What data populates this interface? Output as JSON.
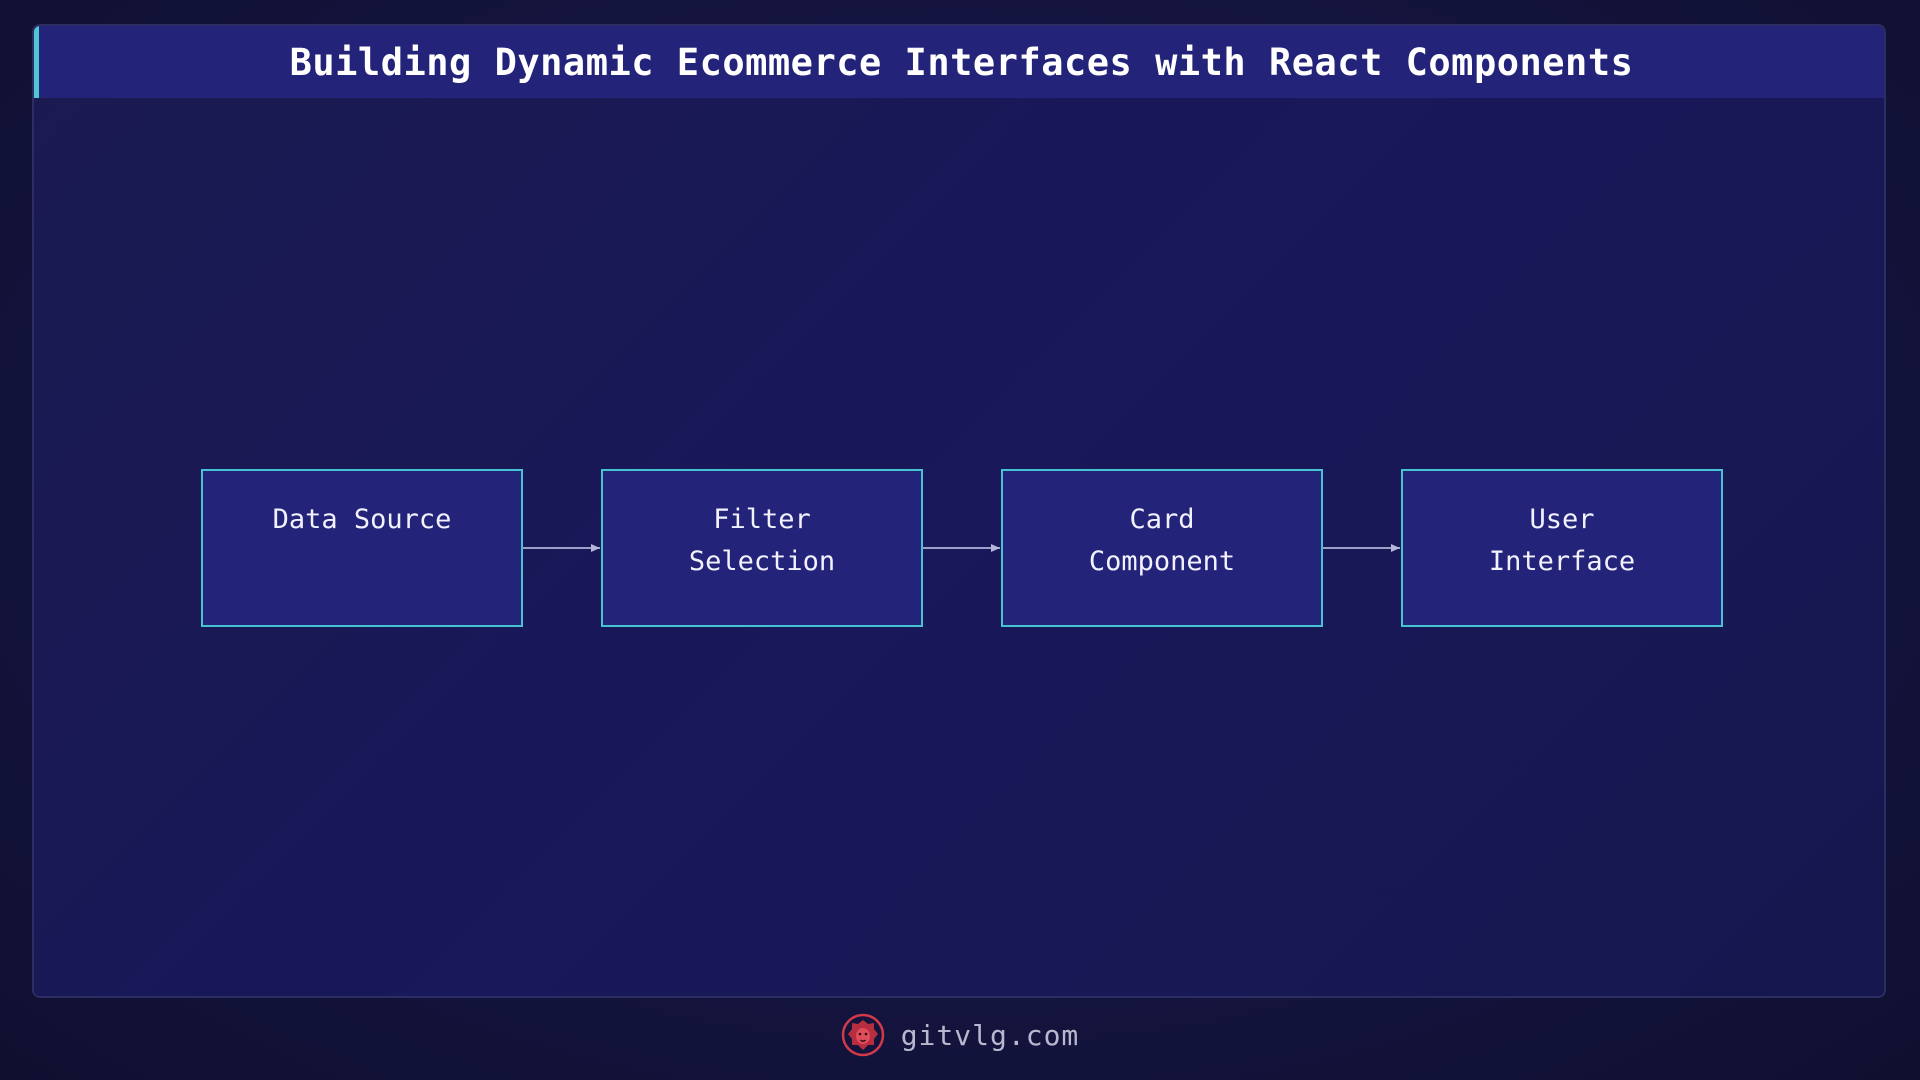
{
  "header": {
    "title": "Building Dynamic Ecommerce Interfaces with React Components"
  },
  "diagram": {
    "nodes": [
      {
        "id": "data-source",
        "label": "Data Source"
      },
      {
        "id": "filter-selection",
        "label": "Filter\nSelection"
      },
      {
        "id": "card-component",
        "label": "Card\nComponent"
      },
      {
        "id": "user-interface",
        "label": "User\nInterface"
      }
    ],
    "edges": [
      {
        "from": "data-source",
        "to": "filter-selection"
      },
      {
        "from": "filter-selection",
        "to": "card-component"
      },
      {
        "from": "card-component",
        "to": "user-interface"
      }
    ]
  },
  "footer": {
    "site": "gitvlg.com",
    "logo_icon": "lion-head-icon"
  },
  "colors": {
    "background": "#141440",
    "title_bar": "#23237a",
    "accent": "#4fc6d4",
    "node_fill": "#23237a",
    "node_border": "#46c3d3",
    "edge": "#9aa0c8",
    "logo": "#d23a4a"
  }
}
